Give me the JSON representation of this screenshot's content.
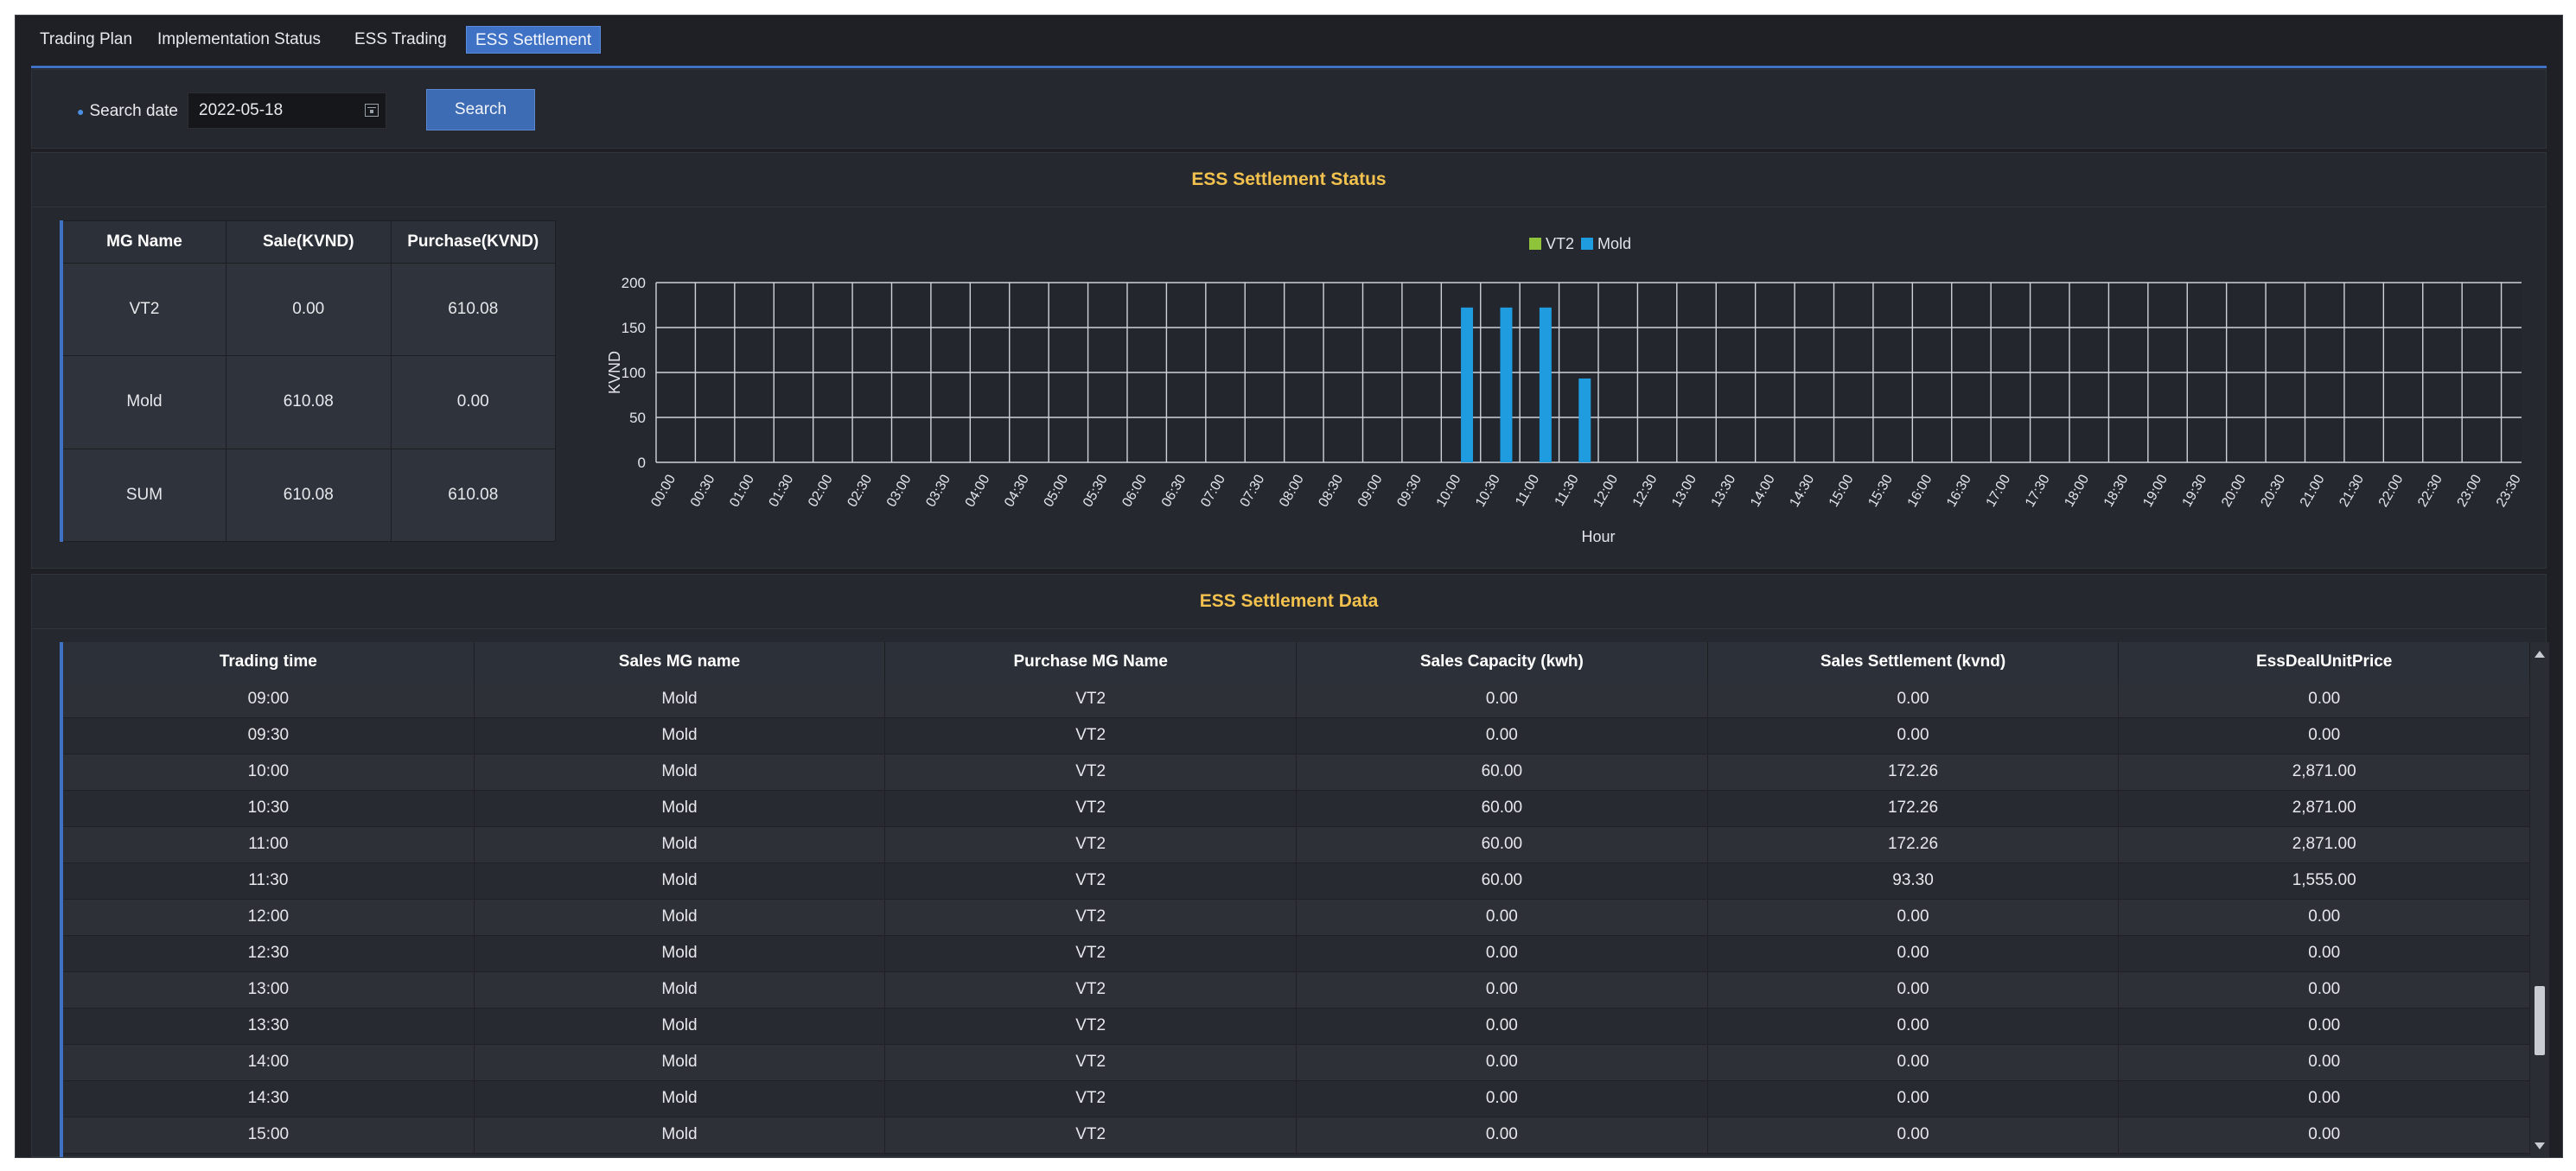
{
  "tabs": [
    "Trading Plan",
    "Implementation Status",
    "ESS Trading",
    "ESS Settlement"
  ],
  "search": {
    "label": "Search date",
    "date_value": "2022-05-18",
    "button_label": "Search"
  },
  "status_panel": {
    "title": "ESS Settlement Status",
    "summary_headers": [
      "MG Name",
      "Sale(KVND)",
      "Purchase(KVND)"
    ],
    "summary_rows": [
      [
        "VT2",
        "0.00",
        "610.08"
      ],
      [
        "Mold",
        "610.08",
        "0.00"
      ],
      [
        "SUM",
        "610.08",
        "610.08"
      ]
    ]
  },
  "chart_data": {
    "type": "bar",
    "xlabel": "Hour",
    "ylabel": "KVND",
    "ylim": [
      0,
      200
    ],
    "yticks": [
      0,
      50,
      100,
      150,
      200
    ],
    "grid": true,
    "legend_position": "top-center",
    "categories": [
      "00:00",
      "00:30",
      "01:00",
      "01:30",
      "02:00",
      "02:30",
      "03:00",
      "03:30",
      "04:00",
      "04:30",
      "05:00",
      "05:30",
      "06:00",
      "06:30",
      "07:00",
      "07:30",
      "08:00",
      "08:30",
      "09:00",
      "09:30",
      "10:00",
      "10:30",
      "11:00",
      "11:30",
      "12:00",
      "12:30",
      "13:00",
      "13:30",
      "14:00",
      "14:30",
      "15:00",
      "15:30",
      "16:00",
      "16:30",
      "17:00",
      "17:30",
      "18:00",
      "18:30",
      "19:00",
      "19:30",
      "20:00",
      "20:30",
      "21:00",
      "21:30",
      "22:00",
      "22:30",
      "23:00",
      "23:30"
    ],
    "series": [
      {
        "name": "VT2",
        "color": "#8fc43a",
        "values": [
          0,
          0,
          0,
          0,
          0,
          0,
          0,
          0,
          0,
          0,
          0,
          0,
          0,
          0,
          0,
          0,
          0,
          0,
          0,
          0,
          0,
          0,
          0,
          0,
          0,
          0,
          0,
          0,
          0,
          0,
          0,
          0,
          0,
          0,
          0,
          0,
          0,
          0,
          0,
          0,
          0,
          0,
          0,
          0,
          0,
          0,
          0,
          0
        ]
      },
      {
        "name": "Mold",
        "color": "#1f9be0",
        "values": [
          0,
          0,
          0,
          0,
          0,
          0,
          0,
          0,
          0,
          0,
          0,
          0,
          0,
          0,
          0,
          0,
          0,
          0,
          0,
          0,
          172.26,
          172.26,
          172.26,
          93.3,
          0,
          0,
          0,
          0,
          0,
          0,
          0,
          0,
          0,
          0,
          0,
          0,
          0,
          0,
          0,
          0,
          0,
          0,
          0,
          0,
          0,
          0,
          0,
          0
        ]
      }
    ]
  },
  "data_panel": {
    "title": "ESS Settlement Data",
    "headers": [
      "Trading time",
      "Sales MG name",
      "Purchase MG Name",
      "Sales Capacity (kwh)",
      "Sales Settlement (kvnd)",
      "EssDealUnitPrice"
    ],
    "rows": [
      [
        "09:00",
        "Mold",
        "VT2",
        "0.00",
        "0.00",
        "0.00"
      ],
      [
        "09:30",
        "Mold",
        "VT2",
        "0.00",
        "0.00",
        "0.00"
      ],
      [
        "10:00",
        "Mold",
        "VT2",
        "60.00",
        "172.26",
        "2,871.00"
      ],
      [
        "10:30",
        "Mold",
        "VT2",
        "60.00",
        "172.26",
        "2,871.00"
      ],
      [
        "11:00",
        "Mold",
        "VT2",
        "60.00",
        "172.26",
        "2,871.00"
      ],
      [
        "11:30",
        "Mold",
        "VT2",
        "60.00",
        "93.30",
        "1,555.00"
      ],
      [
        "12:00",
        "Mold",
        "VT2",
        "0.00",
        "0.00",
        "0.00"
      ],
      [
        "12:30",
        "Mold",
        "VT2",
        "0.00",
        "0.00",
        "0.00"
      ],
      [
        "13:00",
        "Mold",
        "VT2",
        "0.00",
        "0.00",
        "0.00"
      ],
      [
        "13:30",
        "Mold",
        "VT2",
        "0.00",
        "0.00",
        "0.00"
      ],
      [
        "14:00",
        "Mold",
        "VT2",
        "0.00",
        "0.00",
        "0.00"
      ],
      [
        "14:30",
        "Mold",
        "VT2",
        "0.00",
        "0.00",
        "0.00"
      ],
      [
        "15:00",
        "Mold",
        "VT2",
        "0.00",
        "0.00",
        "0.00"
      ]
    ]
  }
}
